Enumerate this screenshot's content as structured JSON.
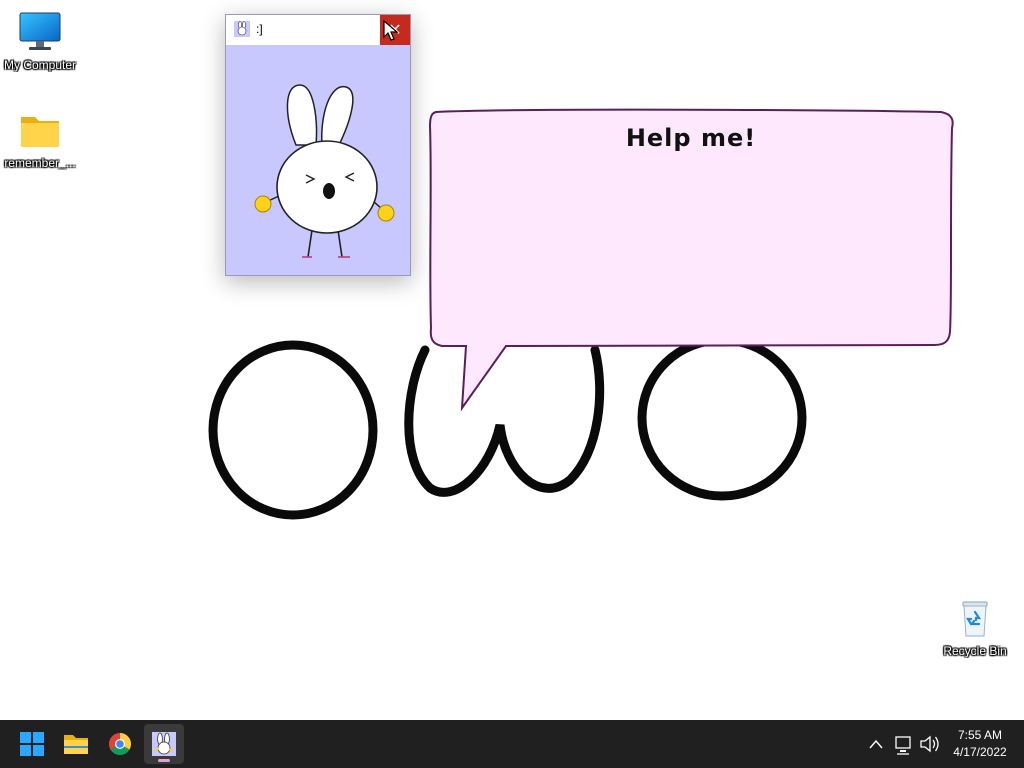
{
  "desktop": {
    "icons": [
      {
        "label": "My Computer",
        "icon": "monitor-icon"
      },
      {
        "label": "remember_...",
        "icon": "folder-icon"
      },
      {
        "label": "Recycle Bin",
        "icon": "recycle-bin-icon"
      }
    ],
    "drawing_text": "owo"
  },
  "bubble": {
    "text": "Help me!",
    "fill": "#fde8fd",
    "stroke": "#5a1f5a"
  },
  "window": {
    "title": ":]",
    "close_glyph": "✕",
    "background": "#c8c8ff"
  },
  "taskbar": {
    "items": [
      {
        "name": "start",
        "icon": "windows-start-icon"
      },
      {
        "name": "file-explorer",
        "icon": "folder-icon"
      },
      {
        "name": "chrome",
        "icon": "chrome-icon"
      },
      {
        "name": "bunny-app",
        "icon": "bunny-icon",
        "active": true
      }
    ],
    "tray": [
      "chevron-up-icon",
      "network-icon",
      "volume-icon"
    ],
    "time": "7:55 AM",
    "date": "4/17/2022"
  }
}
